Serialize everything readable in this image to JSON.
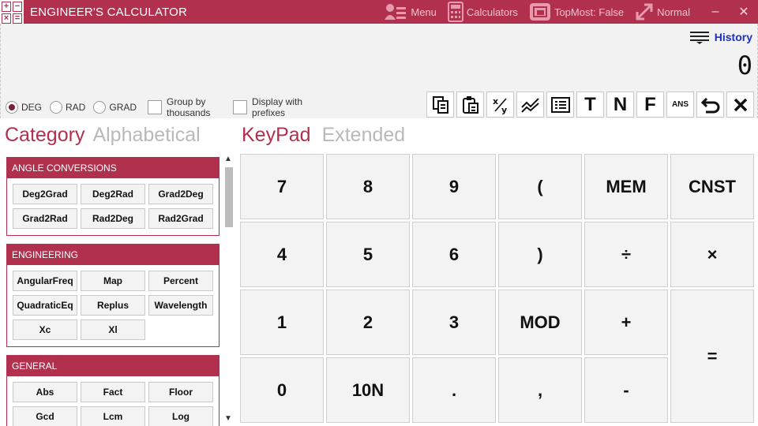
{
  "window": {
    "title": "ENGINEER'S CALCULATOR",
    "menu_label": "Menu",
    "calculators_label": "Calculators",
    "topmost_label": "TopMost: False",
    "normal_label": "Normal",
    "minimize": "–",
    "close": "✕"
  },
  "display": {
    "history_label": "History",
    "result": "0"
  },
  "modes": {
    "deg": "DEG",
    "rad": "RAD",
    "grad": "GRAD",
    "selected": "DEG",
    "group_thousands": "Group by thousands",
    "display_prefixes": "Display with prefixes"
  },
  "tools": {
    "t_label": "T",
    "n_label": "N",
    "f_label": "F",
    "ans_label": "ANS"
  },
  "left_tabs": {
    "category": "Category",
    "alphabetical": "Alphabetical"
  },
  "groups": [
    {
      "name": "ANGLE CONVERSIONS",
      "buttons": [
        "Deg2Grad",
        "Deg2Rad",
        "Grad2Deg",
        "Grad2Rad",
        "Rad2Deg",
        "Rad2Grad"
      ]
    },
    {
      "name": "ENGINEERING",
      "buttons": [
        "AngularFreq",
        "Map",
        "Percent",
        "QuadraticEq",
        "Replus",
        "Wavelength",
        "Xc",
        "Xl"
      ]
    },
    {
      "name": "GENERAL",
      "buttons": [
        "Abs",
        "Fact",
        "Floor",
        "Gcd",
        "Lcm",
        "Log"
      ]
    }
  ],
  "right_tabs": {
    "keypad": "KeyPad",
    "extended": "Extended"
  },
  "keys": [
    "7",
    "8",
    "9",
    "(",
    "MEM",
    "CNST",
    "4",
    "5",
    "6",
    ")",
    "÷",
    "×",
    "1",
    "2",
    "3",
    "MOD",
    "+",
    "=",
    "0",
    "10N",
    ".",
    ",",
    "-"
  ],
  "colors": {
    "accent": "#b0304e",
    "history": "#1f2fbf"
  }
}
